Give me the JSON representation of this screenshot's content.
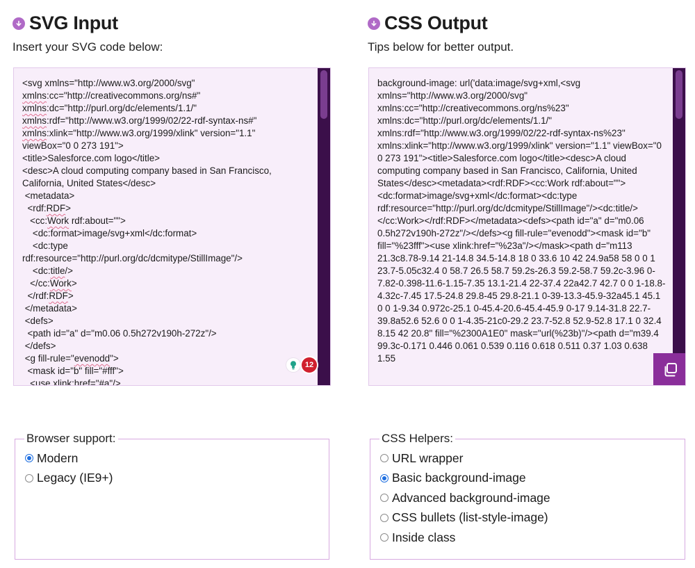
{
  "colors": {
    "accent": "#8a2e9a",
    "editor_bg": "#f8eefa",
    "scrollbar": "#3b0f4a",
    "badge": "#d0202e",
    "radio_selected": "#1f6fe0"
  },
  "left": {
    "title": "SVG Input",
    "title_icon": "arrow-down-circle-icon",
    "subtitle": "Insert your SVG code below:",
    "code_lines": [
      [
        {
          "t": "<svg xmlns=\"http://www.w3.org/2000/svg\""
        }
      ],
      [
        {
          "t": "xmlns",
          "sq": true
        },
        {
          "t": ":cc=\"http://creativecommons.org/ns#\""
        }
      ],
      [
        {
          "t": "xmlns",
          "sq": true
        },
        {
          "t": ":dc=\"http://purl.org/dc/elements/1.1/\""
        }
      ],
      [
        {
          "t": "xmlns",
          "sq": true
        },
        {
          "t": ":rdf=\"http://www.w3.org/1999/02/22-rdf-syntax-ns#\""
        }
      ],
      [
        {
          "t": "xmlns",
          "sq": true
        },
        {
          "t": ":xlink=\"http://www.w3.org/1999/xlink\" version=\"1.1\""
        }
      ],
      [
        {
          "t": "viewBox=\"0 0 273 191\">"
        }
      ],
      [
        {
          "t": "<title>Salesforce.com logo</title>"
        }
      ],
      [
        {
          "t": "<desc>A cloud computing company based in San Francisco,"
        }
      ],
      [
        {
          "t": "California, United States</desc>"
        }
      ],
      [
        {
          "t": " <metadata>"
        }
      ],
      [
        {
          "t": "  <rdf:"
        },
        {
          "t": "RDF",
          "sq": true
        },
        {
          "t": ">"
        }
      ],
      [
        {
          "t": "   <cc:"
        },
        {
          "t": "Work",
          "sq": true
        },
        {
          "t": " rdf:about=\"\">"
        }
      ],
      [
        {
          "t": "    <dc:format>image/svg+xml</dc:format>"
        }
      ],
      [
        {
          "t": "    <dc:type"
        }
      ],
      [
        {
          "t": "rdf:resource=\"http://purl.org/dc/dcmitype/StillImage\"/>"
        }
      ],
      [
        {
          "t": "    <dc:"
        },
        {
          "t": "title",
          "sq": true
        },
        {
          "t": "/>"
        }
      ],
      [
        {
          "t": "   </cc:"
        },
        {
          "t": "Work",
          "sq": true
        },
        {
          "t": ">"
        }
      ],
      [
        {
          "t": "  </rdf:"
        },
        {
          "t": "RDF",
          "sq": true
        },
        {
          "t": ">"
        }
      ],
      [
        {
          "t": " </metadata>"
        }
      ],
      [
        {
          "t": " <defs>"
        }
      ],
      [
        {
          "t": "  <path id=\"a\" d=\"m0.06 0.5h272v190h-272z\"/>"
        }
      ],
      [
        {
          "t": " </defs>"
        }
      ],
      [
        {
          "t": " <g fill-rule=\""
        },
        {
          "t": "evenodd",
          "sq": true
        },
        {
          "t": "\">"
        }
      ],
      [
        {
          "t": "  <mask id=\"b\" fill=\"#fff\">"
        }
      ],
      [
        {
          "t": "   <use xlink:href=\"#a\"/>"
        }
      ]
    ],
    "badge_icon": "lightbulb-icon",
    "badge_count": "12",
    "fieldset": {
      "legend": "Browser support:",
      "options": [
        {
          "label": "Modern",
          "selected": true
        },
        {
          "label": "Legacy (IE9+)",
          "selected": false
        }
      ]
    }
  },
  "right": {
    "title": "CSS Output",
    "title_icon": "arrow-down-circle-icon",
    "subtitle": "Tips below for better output.",
    "code": "background-image: url('data:image/svg+xml,<svg xmlns=\"http://www.w3.org/2000/svg\" xmlns:cc=\"http://creativecommons.org/ns%23\" xmlns:dc=\"http://purl.org/dc/elements/1.1/\" xmlns:rdf=\"http://www.w3.org/1999/02/22-rdf-syntax-ns%23\" xmlns:xlink=\"http://www.w3.org/1999/xlink\" version=\"1.1\" viewBox=\"0 0 273 191\"><title>Salesforce.com logo</title><desc>A cloud computing company based in San Francisco, California, United States</desc><metadata><rdf:RDF><cc:Work rdf:about=\"\"><dc:format>image/svg+xml</dc:format><dc:type rdf:resource=\"http://purl.org/dc/dcmitype/StillImage\"/><dc:title/></cc:Work></rdf:RDF></metadata><defs><path id=\"a\" d=\"m0.06 0.5h272v190h-272z\"/></defs><g fill-rule=\"evenodd\"><mask id=\"b\" fill=\"%23fff\"><use xlink:href=\"%23a\"/></mask><path d=\"m113 21.3c8.78-9.14 21-14.8 34.5-14.8 18 0 33.6 10 42 24.9a58 58 0 0 1 23.7-5.05c32.4 0 58.7 26.5 58.7 59.2s-26.3 59.2-58.7 59.2c-3.96 0-7.82-0.398-11.6-1.15-7.35 13.1-21.4 22-37.4 22a42.7 42.7 0 0 1-18.8-4.32c-7.45 17.5-24.8 29.8-45 29.8-21.1 0-39-13.3-45.9-32a45.1 45.1 0 0 1-9.34 0.972c-25.1 0-45.4-20.6-45.4-45.9 0-17 9.14-31.8 22.7-39.8a52.6 52.6 0 0 1-4.35-21c0-29.2 23.7-52.8 52.9-52.8 17.1 0 32.4 8.15 42 20.8\" fill=\"%2300A1E0\" mask=\"url(%23b)\"/><path d=\"m39.4 99.3c-0.171 0.446 0.061 0.539 0.116 0.618 0.511 0.37 1.03 0.638 1.55",
    "copy_icon": "copy-icon",
    "fieldset": {
      "legend": "CSS Helpers:",
      "options": [
        {
          "label": "URL wrapper",
          "selected": false
        },
        {
          "label": "Basic background-image",
          "selected": true
        },
        {
          "label": "Advanced background-image",
          "selected": false
        },
        {
          "label": "CSS bullets (list-style-image)",
          "selected": false
        },
        {
          "label": "Inside class",
          "selected": false
        }
      ]
    }
  }
}
